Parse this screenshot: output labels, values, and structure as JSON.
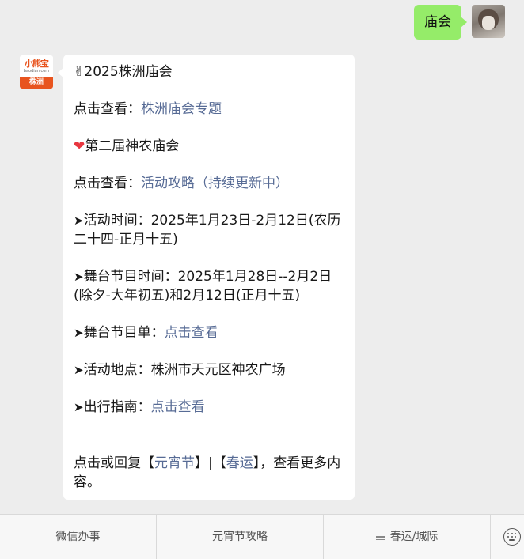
{
  "chat": {
    "user_message": "庙会",
    "bot_logo": {
      "text": "小熊宝",
      "url": "baodian.com",
      "city": "株洲"
    },
    "bot_message": {
      "line1_emoji": "✌",
      "line1_text": "2025株洲庙会",
      "line2_prefix": "点击查看：",
      "line2_link": "株洲庙会专题",
      "line3_emoji": "❤",
      "line3_text": "第二届神农庙会",
      "line4_prefix": "点击查看：",
      "line4_link": "活动攻略（持续更新中）",
      "time_arrow": "➤",
      "time_text": "活动时间：2025年1月23日-2月12日(农历二十四-正月十五)",
      "stage_time_arrow": "➤",
      "stage_time_text": "舞台节目时间：2025年1月28日--2月2日(除夕-大年初五)和2月12日(正月十五)",
      "stage_list_arrow": "➤",
      "stage_list_prefix": "舞台节目单：",
      "stage_list_link": "点击查看",
      "place_arrow": "➤",
      "place_text": "活动地点：株洲市天元区神农广场",
      "guide_arrow": "➤",
      "guide_prefix": "出行指南：",
      "guide_link": "点击查看",
      "footer_prefix": "点击或回复【",
      "footer_link1": "元宵节",
      "footer_mid": "】|【",
      "footer_link2": "春运",
      "footer_suffix": "】，查看更多内容。"
    }
  },
  "bottom_menu": {
    "item1": "微信办事",
    "item2": "元宵节攻略",
    "item3": "春运/城际",
    "keyboard_icon": "keyboard-icon"
  },
  "colors": {
    "user_bubble": "#95ec69",
    "link": "#576b95",
    "background": "#ededed",
    "logo_accent": "#e8541e"
  }
}
